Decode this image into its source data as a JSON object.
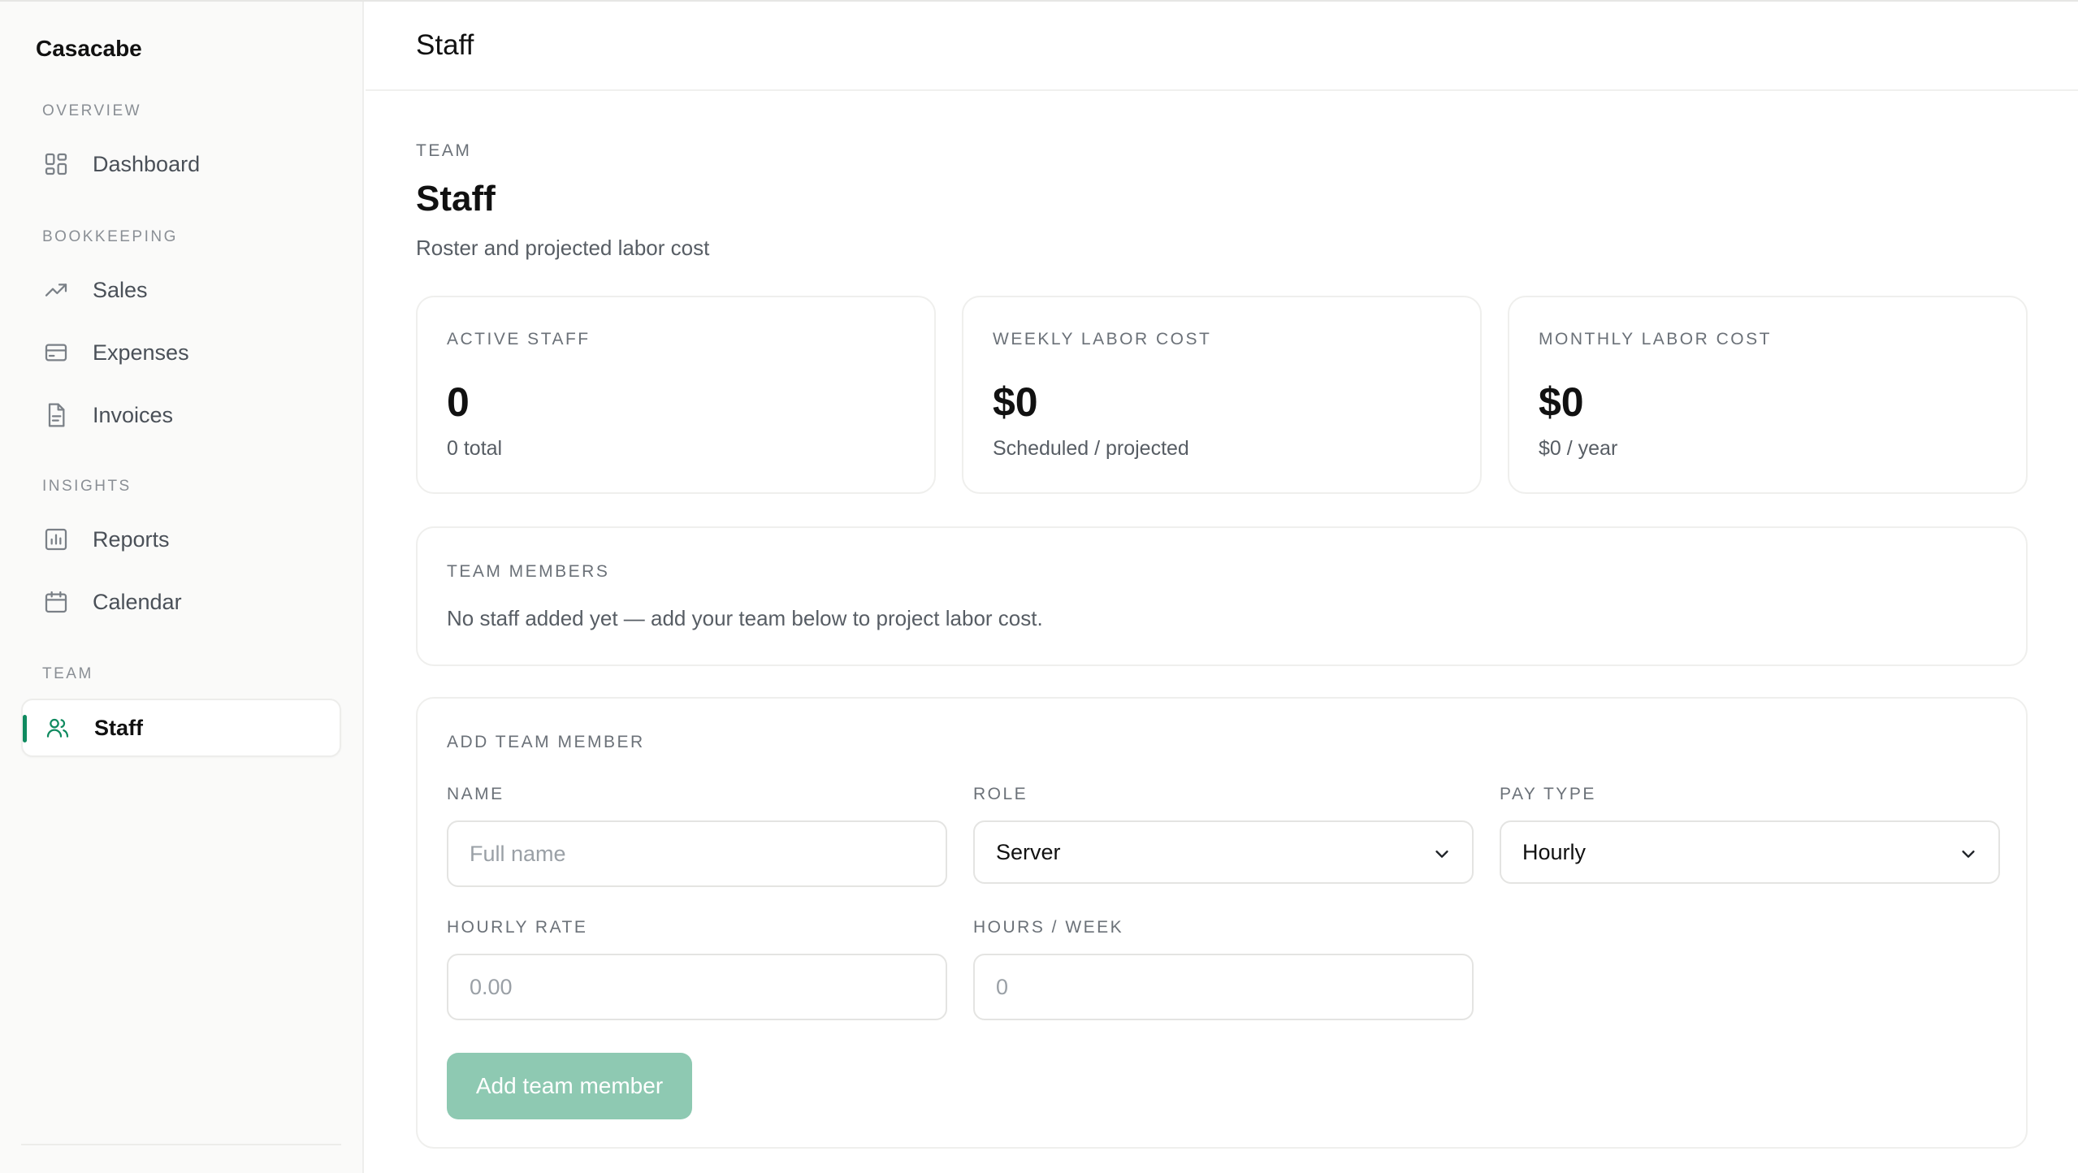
{
  "sidebar": {
    "brand": "Casacabe",
    "sections": {
      "overview": "OVERVIEW",
      "bookkeeping": "BOOKKEEPING",
      "insights": "INSIGHTS",
      "team": "TEAM"
    },
    "items": {
      "dashboard": {
        "label": "Dashboard",
        "icon": "grid-icon"
      },
      "sales": {
        "label": "Sales",
        "icon": "trend-up-icon"
      },
      "expenses": {
        "label": "Expenses",
        "icon": "credit-card-icon"
      },
      "invoices": {
        "label": "Invoices",
        "icon": "document-icon"
      },
      "reports": {
        "label": "Reports",
        "icon": "bar-chart-icon"
      },
      "calendar": {
        "label": "Calendar",
        "icon": "calendar-icon"
      },
      "staff": {
        "label": "Staff",
        "icon": "users-icon",
        "active": true
      }
    }
  },
  "topbar": {
    "title": "Staff"
  },
  "page": {
    "eyebrow": "TEAM",
    "title": "Staff",
    "subtitle": "Roster and projected labor cost"
  },
  "stats": {
    "active_staff": {
      "label": "ACTIVE STAFF",
      "value": "0",
      "sub": "0 total"
    },
    "weekly_cost": {
      "label": "WEEKLY LABOR COST",
      "value": "$0",
      "sub": "Scheduled / projected"
    },
    "monthly_cost": {
      "label": "MONTHLY LABOR COST",
      "value": "$0",
      "sub": "$0 / year"
    }
  },
  "team_members": {
    "heading": "TEAM MEMBERS",
    "empty": "No staff added yet — add your team below to project labor cost."
  },
  "add_member": {
    "heading": "ADD TEAM MEMBER",
    "name": {
      "label": "NAME",
      "placeholder": "Full name",
      "value": ""
    },
    "role": {
      "label": "ROLE",
      "value": "Server"
    },
    "pay_type": {
      "label": "PAY TYPE",
      "value": "Hourly"
    },
    "hourly_rate": {
      "label": "HOURLY RATE",
      "placeholder": "0.00",
      "value": ""
    },
    "hours_week": {
      "label": "HOURS / WEEK",
      "placeholder": "0",
      "value": ""
    },
    "submit_label": "Add team member"
  },
  "colors": {
    "accent": "#0f8a5f",
    "button_disabled": "#8ec9b2",
    "sidebar_bg": "#fafaf9"
  }
}
